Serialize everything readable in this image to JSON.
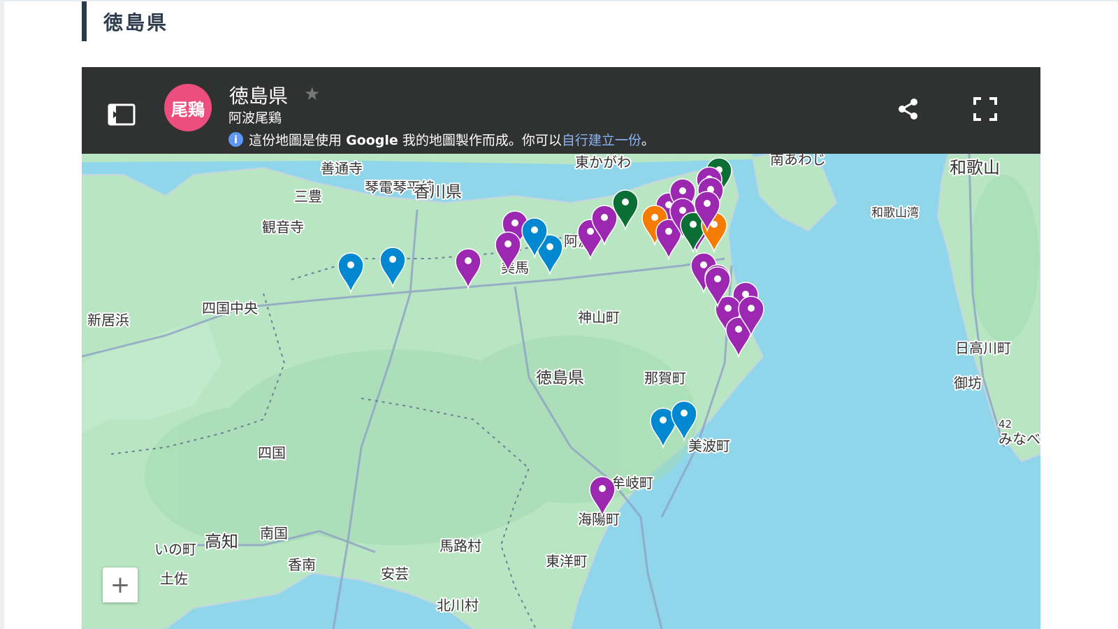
{
  "section": {
    "heading": "徳島県"
  },
  "header": {
    "avatar_text": "尾鶏",
    "title": "徳島県",
    "subtitle": "阿波尾鶏",
    "info_prefix": "這份地圖是使用",
    "info_google": "Google",
    "info_middle": "我的地圖製作而成。你可以",
    "info_link": "自行建立一份",
    "info_suffix": "。"
  },
  "map": {
    "zoom_in_label": "+",
    "labels": [
      {
        "text": "善通寺",
        "size": 20
      },
      {
        "text": "琴電琴平線",
        "size": 20
      },
      {
        "text": "香川県",
        "size": 23
      },
      {
        "text": "三豊",
        "size": 20
      },
      {
        "text": "観音寺",
        "size": 20
      },
      {
        "text": "東かがわ",
        "size": 20
      },
      {
        "text": "南あわじ",
        "size": 20
      },
      {
        "text": "和歌山",
        "size": 24
      },
      {
        "text": "和歌山湾",
        "size": 17
      },
      {
        "text": "阿波",
        "size": 20
      },
      {
        "text": "美馬",
        "size": 20
      },
      {
        "text": "四国中央",
        "size": 20
      },
      {
        "text": "新居浜",
        "size": 20
      },
      {
        "text": "神山町",
        "size": 20
      },
      {
        "text": "徳島県",
        "size": 23
      },
      {
        "text": "那賀町",
        "size": 20
      },
      {
        "text": "日高川町",
        "size": 20
      },
      {
        "text": "御坊",
        "size": 20
      },
      {
        "text": "みなべ",
        "size": 20
      },
      {
        "text": "四国",
        "size": 20
      },
      {
        "text": "美波町",
        "size": 20
      },
      {
        "text": "牟岐町",
        "size": 20
      },
      {
        "text": "海陽町",
        "size": 20
      },
      {
        "text": "いの町",
        "size": 20
      },
      {
        "text": "高知",
        "size": 24
      },
      {
        "text": "南国",
        "size": 20
      },
      {
        "text": "香南",
        "size": 20
      },
      {
        "text": "馬路村",
        "size": 20
      },
      {
        "text": "東洋町",
        "size": 20
      },
      {
        "text": "安芸",
        "size": 20
      },
      {
        "text": "土佐",
        "size": 20
      },
      {
        "text": "北川村",
        "size": 20
      },
      {
        "text": "42",
        "size": 15
      }
    ],
    "pin_colors": {
      "purple": "#9c27b0",
      "blue": "#0288d1",
      "green": "#0b6e34",
      "orange": "#f57c00"
    },
    "pins": [
      {
        "color": "blue"
      },
      {
        "color": "blue"
      },
      {
        "color": "purple"
      },
      {
        "color": "purple"
      },
      {
        "color": "purple"
      },
      {
        "color": "blue"
      },
      {
        "color": "blue"
      },
      {
        "color": "purple"
      },
      {
        "color": "purple"
      },
      {
        "color": "green"
      },
      {
        "color": "purple"
      },
      {
        "color": "purple"
      },
      {
        "color": "orange"
      },
      {
        "color": "purple"
      },
      {
        "color": "purple"
      },
      {
        "color": "purple"
      },
      {
        "color": "green"
      },
      {
        "color": "orange"
      },
      {
        "color": "purple"
      },
      {
        "color": "purple"
      },
      {
        "color": "green"
      },
      {
        "color": "purple"
      },
      {
        "color": "purple"
      },
      {
        "color": "purple"
      },
      {
        "color": "purple"
      },
      {
        "color": "purple"
      },
      {
        "color": "purple"
      },
      {
        "color": "blue"
      },
      {
        "color": "blue"
      },
      {
        "color": "purple"
      },
      {
        "color": "purple"
      },
      {
        "color": "purple"
      }
    ]
  }
}
